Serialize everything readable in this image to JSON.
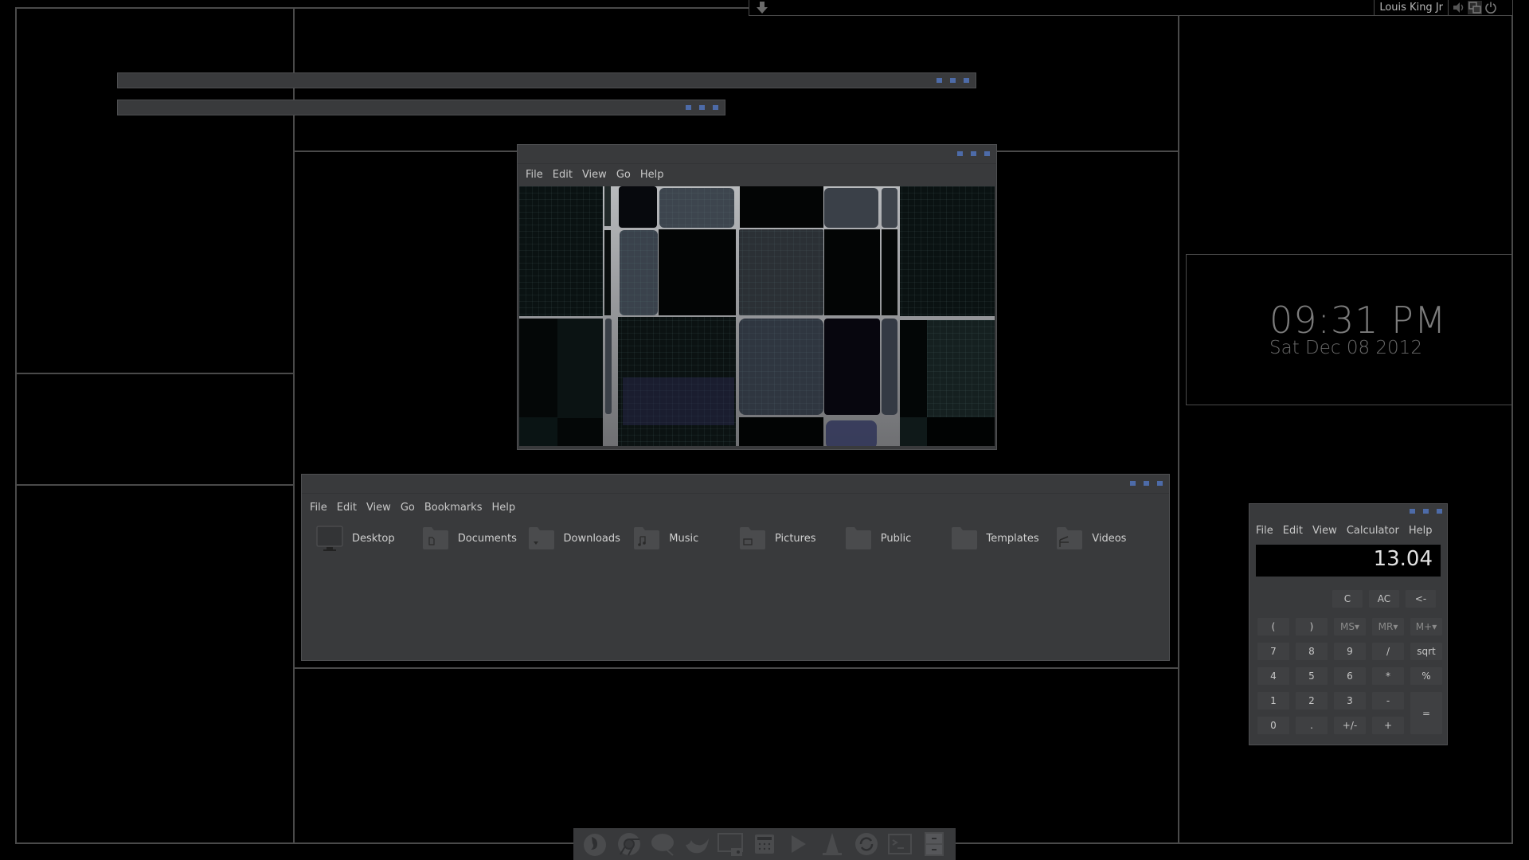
{
  "top_panel": {
    "user_name": "Louis King Jr",
    "icons": [
      "download-arrow-icon",
      "volume-icon",
      "window-switcher-icon",
      "power-icon"
    ]
  },
  "image_viewer": {
    "menu": [
      "File",
      "Edit",
      "View",
      "Go",
      "Help"
    ]
  },
  "file_manager": {
    "menu": [
      "File",
      "Edit",
      "View",
      "Go",
      "Bookmarks",
      "Help"
    ],
    "items": [
      {
        "label": "Desktop",
        "icon": "desktop-icon"
      },
      {
        "label": "Documents",
        "icon": "documents-folder-icon"
      },
      {
        "label": "Downloads",
        "icon": "downloads-folder-icon"
      },
      {
        "label": "Music",
        "icon": "music-folder-icon"
      },
      {
        "label": "Pictures",
        "icon": "pictures-folder-icon"
      },
      {
        "label": "Public",
        "icon": "public-folder-icon"
      },
      {
        "label": "Templates",
        "icon": "templates-folder-icon"
      },
      {
        "label": "Videos",
        "icon": "videos-folder-icon"
      }
    ]
  },
  "clock": {
    "time": "09:31 PM",
    "date": "Sat Dec 08 2012"
  },
  "calculator": {
    "menu": [
      "File",
      "Edit",
      "View",
      "Calculator",
      "Help"
    ],
    "display": "13.04",
    "top_buttons": [
      "C",
      "AC",
      "<-"
    ],
    "rows": [
      [
        "(",
        ")",
        "MS▾",
        "MR▾",
        "M+▾"
      ],
      [
        "7",
        "8",
        "9",
        "/",
        "sqrt"
      ],
      [
        "4",
        "5",
        "6",
        "*",
        "%"
      ],
      [
        "1",
        "2",
        "3",
        "-",
        "="
      ],
      [
        "0",
        ".",
        "+/-",
        "+"
      ]
    ]
  },
  "dock": {
    "apps": [
      "firefox-icon",
      "chrome-icon",
      "chat-icon",
      "thunderbird-icon",
      "screen-capture-icon",
      "calculator-icon",
      "media-player-icon",
      "vlc-icon",
      "update-icon",
      "terminal-icon",
      "file-cabinet-icon"
    ]
  },
  "colors": {
    "window_bg": "#393a3c",
    "accent_dots": "#4d6ba8",
    "grid_lines": "#4a4a4a"
  }
}
